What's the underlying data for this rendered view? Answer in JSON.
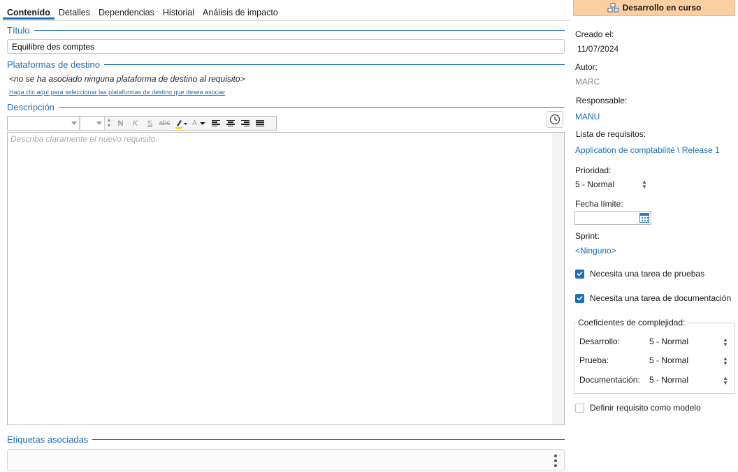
{
  "tabs": [
    {
      "label": "Contenido",
      "active": true
    },
    {
      "label": "Detalles",
      "active": false
    },
    {
      "label": "Dependencias",
      "active": false
    },
    {
      "label": "Historial",
      "active": false
    },
    {
      "label": "Análisis de impacto",
      "active": false
    }
  ],
  "title_section": {
    "heading": "Título",
    "value": "Equilibre des comptes"
  },
  "platforms_section": {
    "heading": "Plataformas de destino",
    "note": "<no se ha asociado ninguna plataforma de destino al requisito>",
    "link": "Haga clic aquí para seleccionar las plataformas de destino que desea asociar"
  },
  "description_section": {
    "heading": "Descripción",
    "placeholder": "Describa claramente el nuevo requisito.",
    "toolbar": {
      "bold": "N",
      "italic": "K",
      "underline": "S",
      "strike": "abc",
      "font_color": "A"
    }
  },
  "tags_section": {
    "heading": "Etiquetas asociadas"
  },
  "status_button": {
    "label": "Desarrollo en curso",
    "color": "#fbcfa2"
  },
  "details": {
    "created_label": "Creado el:",
    "created_value": "11/07/2024",
    "author_label": "Autor:",
    "author_value": "MARC",
    "responsible_label": "Responsable:",
    "responsible_value": "MANU",
    "list_label": "Lista de requisitos:",
    "list_value": "Application de comptabilité \\ Release 1",
    "priority_label": "Prioridad:",
    "priority_value": "5 - Normal",
    "deadline_label": "Fecha límite:",
    "deadline_value": "",
    "sprint_label": "Sprint:",
    "sprint_value": "<Ninguno>"
  },
  "checkboxes": {
    "tests": {
      "label": "Necesita una tarea de pruebas",
      "checked": true
    },
    "docs": {
      "label": "Necesita una tarea de documentación",
      "checked": true
    },
    "model": {
      "label": "Definir requisito como modelo",
      "checked": false
    }
  },
  "complexity": {
    "legend": "Coeficientes de complejidad:",
    "rows": [
      {
        "label": "Desarrollo:",
        "value": "5 - Normal"
      },
      {
        "label": "Prueba:",
        "value": "5 - Normal"
      },
      {
        "label": "Documentación:",
        "value": "5 - Normal"
      }
    ]
  },
  "colors": {
    "accent": "#1e6fb5",
    "checkbox": "#1e6fb5"
  }
}
